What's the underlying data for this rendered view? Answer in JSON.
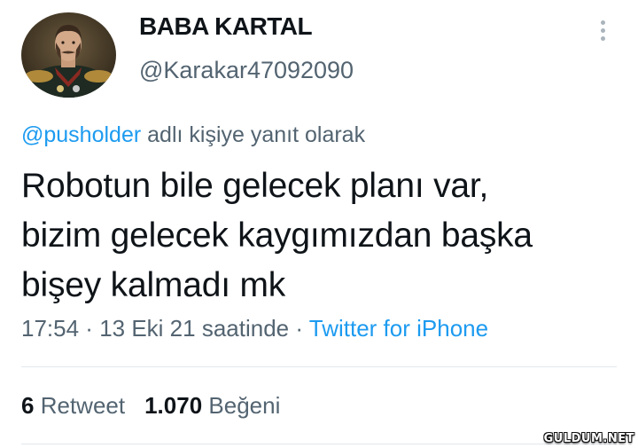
{
  "tweet": {
    "author": {
      "display_name": "BABA KARTAL",
      "handle": "@Karakar47092090",
      "avatar": "portrait-avatar"
    },
    "more_icon": "more-vertical-icon",
    "reply_to": {
      "mention": "@pusholder",
      "suffix": " adlı kişiye yanıt olarak"
    },
    "text_lines": [
      "Robotun bile gelecek planı var,",
      "bizim gelecek kaygımızdan başka",
      "bişey kalmadı mk"
    ],
    "meta": {
      "time": "17:54",
      "separator": " · ",
      "date": "13 Eki 21 saatinde",
      "source": "Twitter for iPhone"
    },
    "stats": {
      "retweets_count": "6",
      "retweets_label": "Retweet",
      "likes_count": "1.070",
      "likes_label": "Beğeni"
    },
    "colors": {
      "text": "#0f1419",
      "secondary": "#536471",
      "link": "#1d9bf0"
    }
  },
  "watermark": "GULDUM.NET"
}
